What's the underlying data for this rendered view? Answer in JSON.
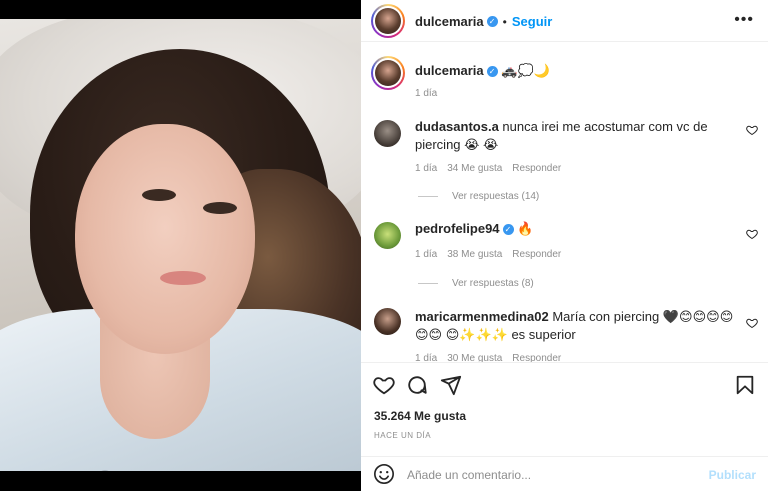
{
  "post": {
    "username": "dulcemaria",
    "follow_label": "Seguir",
    "dot": "•",
    "more": "•••"
  },
  "caption": {
    "username": "dulcemaria",
    "text": "🚓💭🌙",
    "time": "1 día"
  },
  "comments": [
    {
      "username": "dudasantos.a",
      "text": "nunca irei me acostumar com vc de piercing 😭 😭",
      "time": "1 día",
      "likes": "34 Me gusta",
      "reply": "Responder",
      "replies": "Ver respuestas (14)"
    },
    {
      "username": "pedrofelipe94",
      "text": "🔥",
      "time": "1 día",
      "likes": "38 Me gusta",
      "reply": "Responder",
      "replies": "Ver respuestas (8)"
    },
    {
      "username": "maricarmenmedina02",
      "text": "María con piercing 🖤😊😊😊😊😊😊 😊✨✨✨ es superior",
      "time": "1 día",
      "likes": "30 Me gusta",
      "reply": "Responder"
    }
  ],
  "footer": {
    "likes": "35.264 Me gusta",
    "time": "HACE UN DÍA",
    "comment_placeholder": "Añade un comentario...",
    "publish_label": "Publicar"
  },
  "icons": {
    "heart": "heart-icon",
    "comment": "comment-icon",
    "share": "share-icon",
    "save": "bookmark-icon",
    "emoji": "emoji-icon"
  },
  "colors": {
    "link_blue": "#0095f6",
    "verified_blue": "#3897f0",
    "publish_disabled": "#b2dffc",
    "muted": "#8e8e8e"
  }
}
